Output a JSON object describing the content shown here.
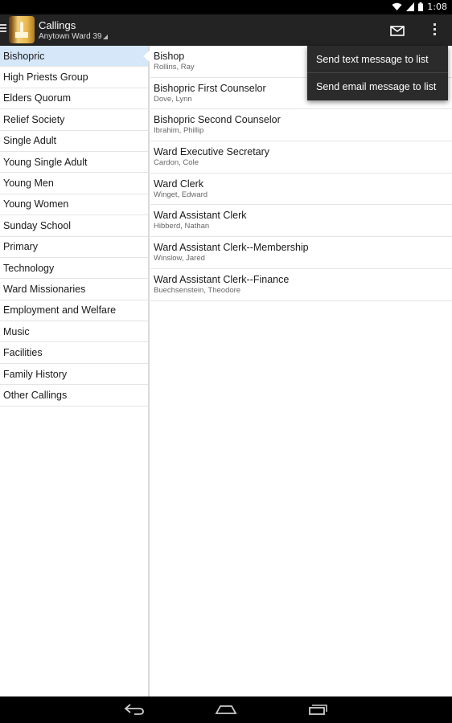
{
  "status_bar": {
    "time": "1:08",
    "icons": [
      "wifi-icon",
      "signal-icon",
      "battery-icon"
    ]
  },
  "action_bar": {
    "title": "Callings",
    "subtitle": "Anytown Ward 39",
    "actions": [
      "mail-icon",
      "overflow-menu-icon"
    ]
  },
  "organizations": [
    {
      "label": "Bishopric",
      "selected": true
    },
    {
      "label": "High Priests Group"
    },
    {
      "label": "Elders Quorum"
    },
    {
      "label": "Relief Society"
    },
    {
      "label": "Single Adult"
    },
    {
      "label": "Young Single Adult"
    },
    {
      "label": "Young Men"
    },
    {
      "label": "Young Women"
    },
    {
      "label": "Sunday School"
    },
    {
      "label": "Primary"
    },
    {
      "label": "Technology"
    },
    {
      "label": "Ward Missionaries"
    },
    {
      "label": "Employment and Welfare"
    },
    {
      "label": "Music"
    },
    {
      "label": "Facilities"
    },
    {
      "label": "Family History"
    },
    {
      "label": "Other Callings"
    }
  ],
  "callings": [
    {
      "title": "Bishop",
      "name": "Rollins, Ray"
    },
    {
      "title": "Bishopric First Counselor",
      "name": "Dove, Lynn"
    },
    {
      "title": "Bishopric Second Counselor",
      "name": "Ibrahim, Phillip"
    },
    {
      "title": "Ward Executive Secretary",
      "name": "Cardon, Cole"
    },
    {
      "title": "Ward Clerk",
      "name": "Winget, Edward"
    },
    {
      "title": "Ward Assistant Clerk",
      "name": "Hibberd, Nathan"
    },
    {
      "title": "Ward Assistant Clerk--Membership",
      "name": "Winslow, Jared"
    },
    {
      "title": "Ward Assistant Clerk--Finance",
      "name": "Buechsenstein, Theodore"
    }
  ],
  "overflow_menu": {
    "items": [
      "Send text message to list",
      "Send email message to list"
    ]
  },
  "nav_bar": {
    "buttons": [
      "back-icon",
      "home-icon",
      "recents-icon"
    ]
  },
  "colors": {
    "action_bar": "#232323",
    "selected_row": "#d6e7f9",
    "popup": "#2b2b2b"
  }
}
